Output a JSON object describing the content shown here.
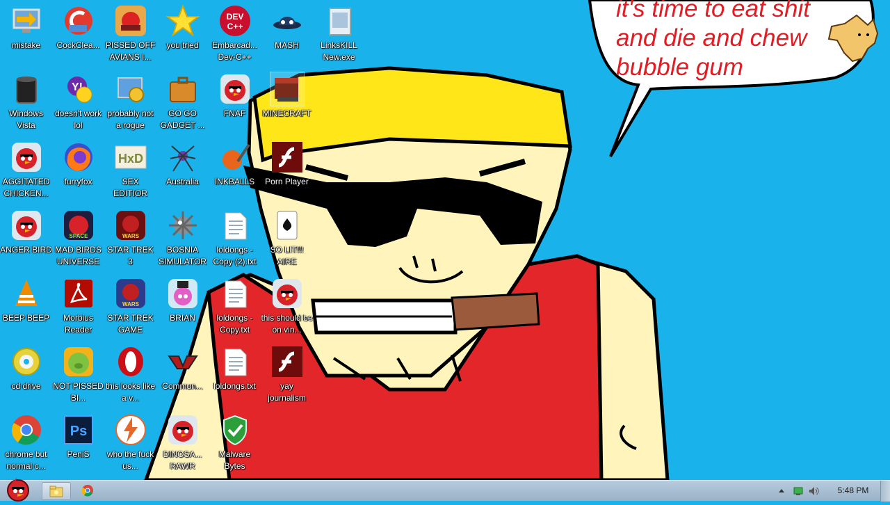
{
  "wallpaper": {
    "speech_lines": [
      "it's time to eat shit",
      "and die and chew",
      "bubble gum"
    ]
  },
  "desktop_icons": [
    {
      "label": "mistake",
      "icon": "computer-icon"
    },
    {
      "label": "CockClea...",
      "icon": "ccleaner-icon"
    },
    {
      "label": "PISSED OFF AVIANS I...",
      "icon": "angry-birds-seasons-icon"
    },
    {
      "label": "you tried",
      "icon": "star-icon"
    },
    {
      "label": "Embarcad... Dev-C++",
      "icon": "devcpp-icon"
    },
    {
      "label": "MASH",
      "icon": "mash-icon"
    },
    {
      "label": "LinksKILL New.exe",
      "icon": "exe-file-icon"
    },
    {
      "label": "Windows Vista",
      "icon": "trash-bin-icon"
    },
    {
      "label": "doesn't work lol",
      "icon": "yahoo-messenger-icon"
    },
    {
      "label": "probably not a rogue",
      "icon": "control-panel-icon"
    },
    {
      "label": "GO GO GADGET ...",
      "icon": "briefcase-icon"
    },
    {
      "label": "FNAF",
      "icon": "angry-bird-icon"
    },
    {
      "label": "MINECRAFT",
      "icon": "minecraft-icon"
    },
    {
      "label": "AGGITATED CHICKEN...",
      "icon": "angry-bird-icon"
    },
    {
      "label": "furryfox",
      "icon": "firefox-icon"
    },
    {
      "label": "SEX EDITIOR",
      "icon": "hxd-icon"
    },
    {
      "label": "Australia",
      "icon": "spider-solitaire-icon"
    },
    {
      "label": "INKBALLS",
      "icon": "inkball-icon"
    },
    {
      "label": "Porn Player",
      "icon": "flash-icon"
    },
    {
      "label": "ANGER BIRD",
      "icon": "angry-bird-icon"
    },
    {
      "label": "MAD BIRDS UNIVERSE",
      "icon": "angry-birds-space-icon"
    },
    {
      "label": "STAR TREK 3",
      "icon": "star-wars-icon"
    },
    {
      "label": "BOSNIA SIMULATOR",
      "icon": "minesweeper-icon"
    },
    {
      "label": "loldongs - Copy (2).txt",
      "icon": "text-file-icon"
    },
    {
      "label": "SO LIT!!! AIRE",
      "icon": "solitaire-icon"
    },
    {
      "label": "BEEP BEEP",
      "icon": "vlc-icon"
    },
    {
      "label": "Morbius Reader",
      "icon": "adobe-reader-icon"
    },
    {
      "label": "STAR TREK GAME",
      "icon": "star-wars-icon"
    },
    {
      "label": "BRIAN",
      "icon": "angry-bird-icon"
    },
    {
      "label": "loldongs - Copy.txt",
      "icon": "text-file-icon"
    },
    {
      "label": "this should be on vin...",
      "icon": "angry-bird-icon"
    },
    {
      "label": "cd drive",
      "icon": "cd-drive-icon"
    },
    {
      "label": "NOT PISSED BI...",
      "icon": "bad-piggies-icon"
    },
    {
      "label": "this looks like a v...",
      "icon": "opera-icon"
    },
    {
      "label": "Commun...",
      "icon": "communist-icon"
    },
    {
      "label": "loldongs.txt",
      "icon": "text-file-icon"
    },
    {
      "label": "yay journalism",
      "icon": "flash-icon"
    },
    {
      "label": "chrome but normal c...",
      "icon": "chrome-icon"
    },
    {
      "label": "PeniS",
      "icon": "photoshop-icon"
    },
    {
      "label": "who the fuck us...",
      "icon": "lightning-icon"
    },
    {
      "label": "DINOSA... RAWR",
      "icon": "angry-bird-icon"
    },
    {
      "label": "Malware Bytes",
      "icon": "shield-icon"
    }
  ],
  "taskbar": {
    "start_icon": "angry-bird-start-icon",
    "pinned": [
      "explorer-icon",
      "chrome-icon"
    ],
    "tray_icons": [
      "show-hidden-icons-arrow",
      "network-icon",
      "volume-icon",
      "action-center-icon"
    ],
    "clock": "5:48 PM"
  },
  "colors": {
    "desktop_bg": "#19b2ea",
    "speech_text": "#e31b23",
    "cap_yellow": "#ffe619",
    "shirt_red": "#e3262a",
    "skin": "#fff5bc"
  }
}
